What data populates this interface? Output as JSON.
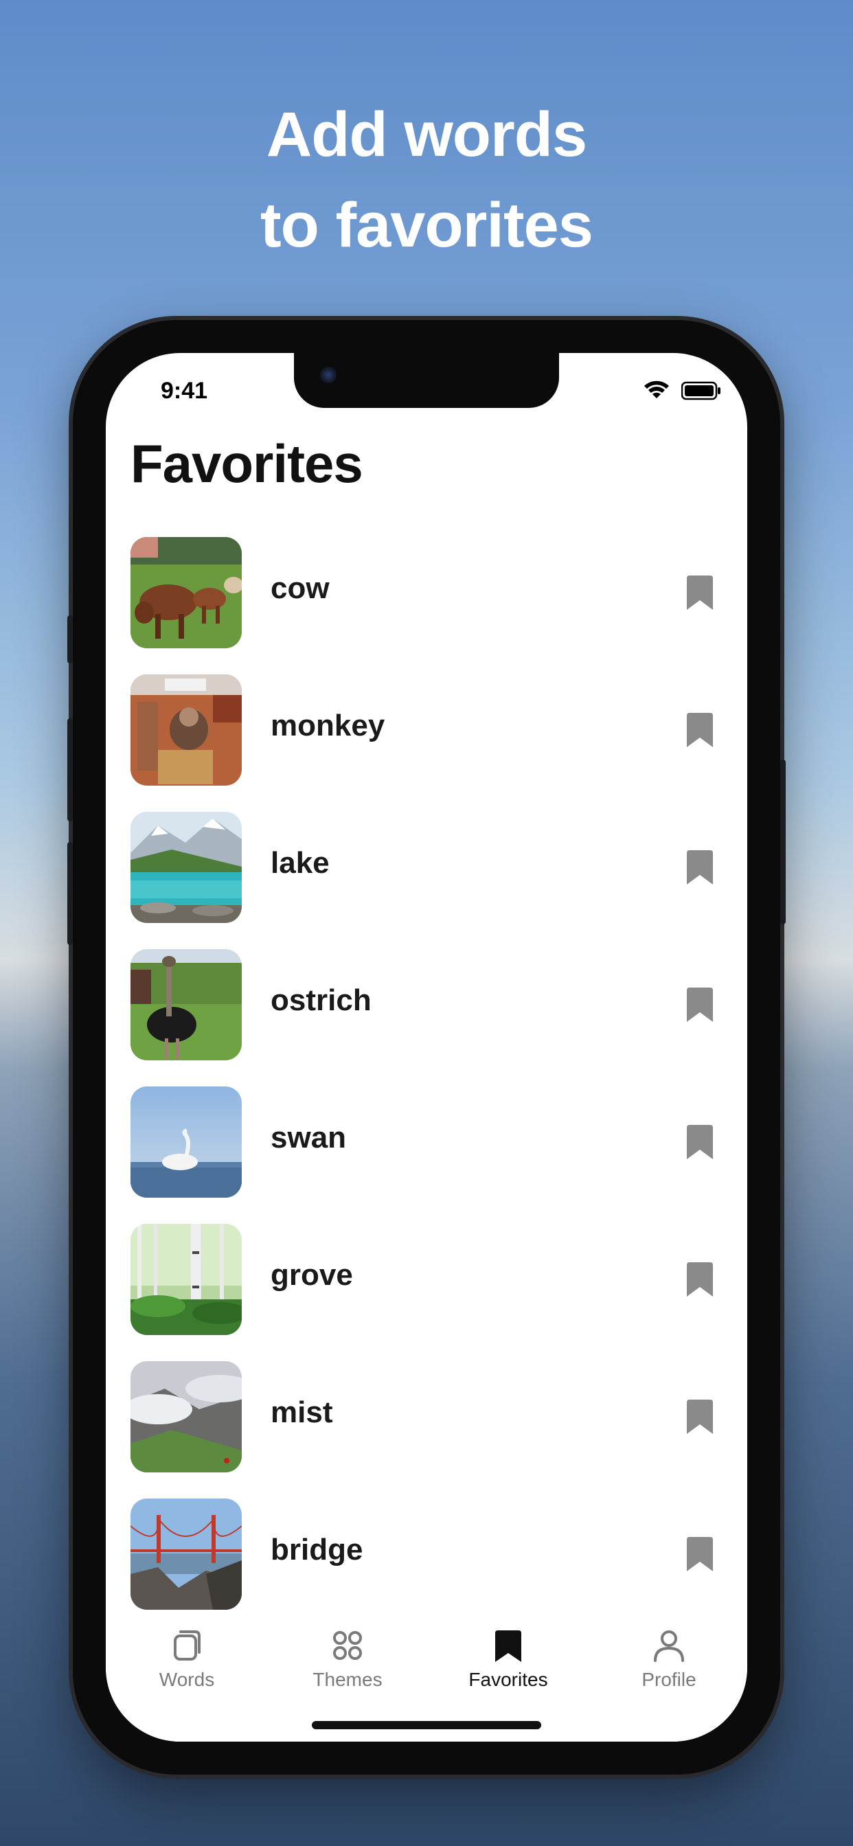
{
  "headline": {
    "line1": "Add words",
    "line2": "to favorites"
  },
  "status": {
    "time": "9:41"
  },
  "page": {
    "title": "Favorites"
  },
  "items": [
    {
      "word": "cow",
      "image": "cow-photo"
    },
    {
      "word": "monkey",
      "image": "monkey-photo"
    },
    {
      "word": "lake",
      "image": "lake-photo"
    },
    {
      "word": "ostrich",
      "image": "ostrich-photo"
    },
    {
      "word": "swan",
      "image": "swan-photo"
    },
    {
      "word": "grove",
      "image": "grove-photo"
    },
    {
      "word": "mist",
      "image": "mist-photo"
    },
    {
      "word": "bridge",
      "image": "bridge-photo"
    }
  ],
  "tabs": [
    {
      "label": "Words",
      "icon": "cards-icon"
    },
    {
      "label": "Themes",
      "icon": "grid-icon"
    },
    {
      "label": "Favorites",
      "icon": "bookmark-icon",
      "active": true
    },
    {
      "label": "Profile",
      "icon": "person-icon"
    }
  ],
  "colors": {
    "bookmark": "#8a8a8a",
    "active_tab": "#111111",
    "inactive_tab": "#7a7a7a"
  }
}
